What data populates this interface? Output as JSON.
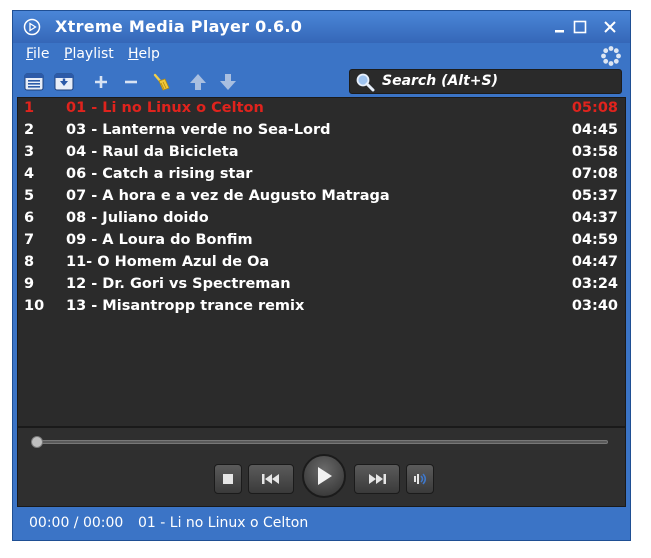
{
  "window": {
    "title": "Xtreme Media Player 0.6.0"
  },
  "menu": {
    "file": {
      "first": "F",
      "rest": "ile"
    },
    "playlist": {
      "first": "P",
      "rest": "laylist"
    },
    "help": {
      "first": "H",
      "rest": "elp"
    }
  },
  "search": {
    "label": "Search  (Alt+S)"
  },
  "colors": {
    "active_track": "#e0231d",
    "frame": "#3b74c6",
    "panel": "#2b2b2b"
  },
  "playlist": {
    "tracks": [
      {
        "num": "1",
        "name": "01 - Li no Linux o Celton",
        "duration": "05:08"
      },
      {
        "num": "2",
        "name": "03 - Lanterna verde no Sea-Lord",
        "duration": "04:45"
      },
      {
        "num": "3",
        "name": "04 - Raul da Bicicleta",
        "duration": "03:58"
      },
      {
        "num": "4",
        "name": "06 - Catch a rising star",
        "duration": "07:08"
      },
      {
        "num": "5",
        "name": "07 - A hora e a vez de Augusto Matraga",
        "duration": "05:37"
      },
      {
        "num": "6",
        "name": "08 - Juliano doido",
        "duration": "04:37"
      },
      {
        "num": "7",
        "name": "09 - A Loura do Bonfim",
        "duration": "04:59"
      },
      {
        "num": "8",
        "name": "11- O Homem Azul de Oa",
        "duration": "04:47"
      },
      {
        "num": "9",
        "name": "12 - Dr. Gori vs Spectreman",
        "duration": "03:24"
      },
      {
        "num": "10",
        "name": "13 - Misantropp trance remix",
        "duration": "03:40"
      }
    ]
  },
  "player": {
    "progress": 0
  },
  "status": {
    "time": "00:00 / 00:00",
    "track": "01 - Li no Linux o Celton"
  }
}
